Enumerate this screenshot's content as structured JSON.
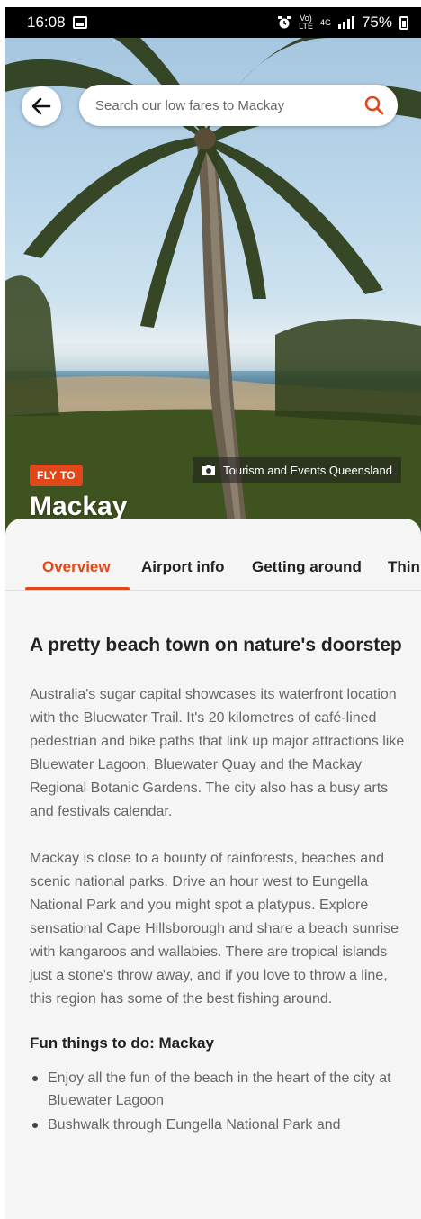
{
  "status_bar": {
    "time": "16:08",
    "network_top": "Vo)",
    "network_bottom": "LTE",
    "network_type": "4G",
    "battery": "75%"
  },
  "header": {
    "back_icon": "arrow-left-icon",
    "search_placeholder": "Search our low fares to Mackay",
    "search_icon": "search-icon"
  },
  "hero": {
    "badge": "FLY TO",
    "title": "Mackay",
    "photo_credit": "Tourism and Events Queensland",
    "credit_icon": "camera-icon"
  },
  "tabs": [
    {
      "label": "Overview",
      "active": true
    },
    {
      "label": "Airport info",
      "active": false
    },
    {
      "label": "Getting around",
      "active": false
    },
    {
      "label": "Thin",
      "active": false
    }
  ],
  "article": {
    "heading": "A pretty beach town on nature's doorstep",
    "paragraphs": [
      "Australia's sugar capital showcases its waterfront location with the Bluewater Trail. It's 20 kilometres of café-lined pedestrian and bike paths that link up major attractions like Bluewater Lagoon, Bluewater Quay and the Mackay Regional Botanic Gardens. The city also has a busy arts and festivals calendar.",
      "Mackay is close to a bounty of rainforests, beaches and scenic national parks. Drive an hour west to Eungella National Park and you might spot a platypus. Explore sensational Cape Hillsborough and share a beach sunrise with kangaroos and wallabies. There are tropical islands just a stone's throw away, and if you love to throw a line, this region has some of the best fishing around."
    ],
    "subheading": "Fun things to do: Mackay",
    "list": [
      "Enjoy all the fun of the beach in the heart of the city at Bluewater Lagoon",
      "Bushwalk through Eungella National Park and"
    ]
  },
  "colors": {
    "accent": "#e0471a",
    "background": "#f5f5f5"
  }
}
